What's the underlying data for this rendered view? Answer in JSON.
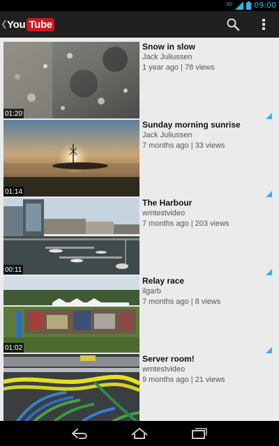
{
  "status_bar": {
    "network": "3G",
    "time": "09:00"
  },
  "action_bar": {
    "logo_you": "You",
    "logo_tube": "Tube"
  },
  "videos": [
    {
      "title": "Snow in slow",
      "author": "Jack Juliussen",
      "meta": "1 year ago | 78 views",
      "duration": "01:20"
    },
    {
      "title": "Sunday morning sunrise",
      "author": "Jack Juliussen",
      "meta": "7 months ago | 33 views",
      "duration": "01:14"
    },
    {
      "title": "The Harbour",
      "author": "wmtestvideo",
      "meta": "7 months ago | 203 views",
      "duration": "00:11"
    },
    {
      "title": "Relay race",
      "author": "ilgarb",
      "meta": "7 months ago | 8 views",
      "duration": "01:02"
    },
    {
      "title": "Server room!",
      "author": "wmtestvideo",
      "meta": "9 months ago | 21 views",
      "duration": ""
    }
  ],
  "colors": {
    "accent": "#33b5e5",
    "logo_red": "#cc181e",
    "action_bar": "#202020"
  }
}
